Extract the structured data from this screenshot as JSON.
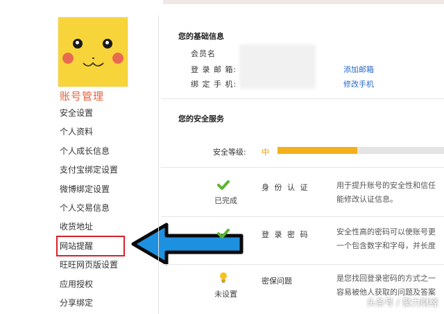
{
  "sidebar": {
    "section_title": "账号管理",
    "items": [
      {
        "label": "安全设置"
      },
      {
        "label": "个人资料"
      },
      {
        "label": "个人成长信息"
      },
      {
        "label": "支付宝绑定设置"
      },
      {
        "label": "微博绑定设置"
      },
      {
        "label": "个人交易信息"
      },
      {
        "label": "收货地址"
      },
      {
        "label": "网站提醒"
      },
      {
        "label": "旺旺网页版设置"
      },
      {
        "label": "应用授权"
      },
      {
        "label": "分享绑定"
      }
    ],
    "highlighted_item": "网站提醒"
  },
  "basic_info": {
    "title": "您的基础信息",
    "member_name_label": "会员名",
    "email_label": "登 录 邮 箱:",
    "email_action": "添加邮箱",
    "phone_label": "绑 定 手 机:",
    "phone_action": "修改手机"
  },
  "security": {
    "title": "您的安全服务",
    "level_label": "安全等级:",
    "level_value": "中",
    "level_progress": 0.48,
    "services": [
      {
        "status": "已完成",
        "icon": "check-icon",
        "name": "身 份 认 证",
        "desc": [
          "用于提升账号的安全性和信任",
          "能修改认证信息。"
        ]
      },
      {
        "status": "",
        "icon": "check-icon",
        "name": "登 录 密 码",
        "desc": [
          "安全性高的密码可以使账号更",
          "一个包含数字和字母，并长度"
        ]
      },
      {
        "status": "未设置",
        "icon": "bulb-icon",
        "name": "密保问题",
        "desc": [
          "是您找回登录密码的方式之一",
          "容易被他人获取的问题及答案"
        ]
      }
    ]
  },
  "watermark": "头条号 / 聚力财经",
  "colors": {
    "accent": "#e0603a",
    "link": "#2a6ac8",
    "highlight": "#d6202a",
    "arrow": "#1e90e0",
    "progress": "#f3b01c"
  }
}
